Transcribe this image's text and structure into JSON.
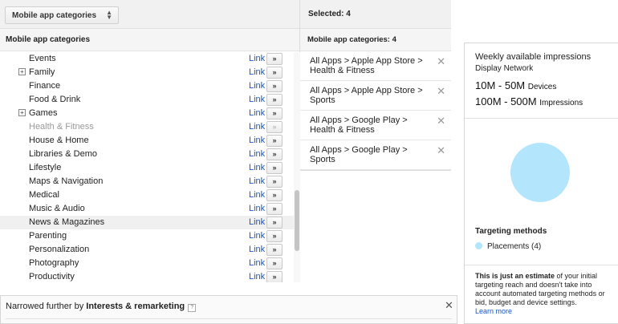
{
  "left": {
    "select_label": "Mobile app categories",
    "header": "Mobile app categories",
    "link_label": "Link",
    "add_label": "»",
    "items": [
      {
        "name": "Events",
        "expand": false,
        "disabled": false,
        "highlight": false
      },
      {
        "name": "Family",
        "expand": true,
        "disabled": false,
        "highlight": false
      },
      {
        "name": "Finance",
        "expand": false,
        "disabled": false,
        "highlight": false
      },
      {
        "name": "Food & Drink",
        "expand": false,
        "disabled": false,
        "highlight": false
      },
      {
        "name": "Games",
        "expand": true,
        "disabled": false,
        "highlight": false
      },
      {
        "name": "Health & Fitness",
        "expand": false,
        "disabled": true,
        "highlight": false
      },
      {
        "name": "House & Home",
        "expand": false,
        "disabled": false,
        "highlight": false
      },
      {
        "name": "Libraries & Demo",
        "expand": false,
        "disabled": false,
        "highlight": false
      },
      {
        "name": "Lifestyle",
        "expand": false,
        "disabled": false,
        "highlight": false
      },
      {
        "name": "Maps & Navigation",
        "expand": false,
        "disabled": false,
        "highlight": false
      },
      {
        "name": "Medical",
        "expand": false,
        "disabled": false,
        "highlight": false
      },
      {
        "name": "Music & Audio",
        "expand": false,
        "disabled": false,
        "highlight": false
      },
      {
        "name": "News & Magazines",
        "expand": false,
        "disabled": false,
        "highlight": true
      },
      {
        "name": "Parenting",
        "expand": false,
        "disabled": false,
        "highlight": false
      },
      {
        "name": "Personalization",
        "expand": false,
        "disabled": false,
        "highlight": false
      },
      {
        "name": "Photography",
        "expand": false,
        "disabled": false,
        "highlight": false
      },
      {
        "name": "Productivity",
        "expand": false,
        "disabled": false,
        "highlight": false
      }
    ]
  },
  "middle": {
    "selected_title": "Selected: 4",
    "header": "Mobile app categories: 4",
    "selected": [
      "All Apps > Apple App Store > Health & Fitness",
      "All Apps > Apple App Store > Sports",
      "All Apps > Google Play > Health & Fitness",
      "All Apps > Google Play > Sports"
    ]
  },
  "right": {
    "title": "Weekly available impressions",
    "network": "Display Network",
    "devices_value": "10M - 50M",
    "devices_label": "Devices",
    "impressions_value": "100M - 500M",
    "impressions_label": "Impressions",
    "methods_title": "Targeting methods",
    "placements": "Placements (4)",
    "note_bold": "This is just an estimate",
    "note_rest": " of your initial targeting reach and doesn't take into account automated targeting methods or bid, budget and device settings.",
    "learn_more": "Learn more",
    "circle_color": "#b3e5fc"
  },
  "bottom": {
    "prefix": "Narrowed further by ",
    "bold": "Interests & remarketing",
    "help": "?",
    "close": "✕"
  },
  "icons": {
    "expand": "+",
    "remove": "✕",
    "select_arrow": "⬍"
  }
}
